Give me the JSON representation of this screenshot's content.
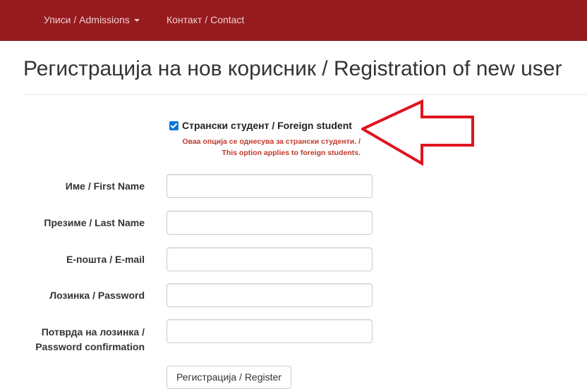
{
  "navbar": {
    "admissions_label": "Уписи / Admissions",
    "contact_label": "Контакт / Contact",
    "background_color": "#951b1e"
  },
  "page": {
    "title": "Регистрација на нов корисник / Registration of new user"
  },
  "foreign_student": {
    "checked": true,
    "label": "Странски студент / Foreign student",
    "note_line1": "Оваа опција се однесува за странски студенти. /",
    "note_line2": "This option applies to foreign students.",
    "note_color": "#c0392b"
  },
  "annotation": {
    "arrow_color": "#e0141e",
    "arrow_direction": "left"
  },
  "form": {
    "fields": [
      {
        "label": "Име / First Name",
        "value": ""
      },
      {
        "label": "Презиме / Last Name",
        "value": ""
      },
      {
        "label": "Е-пошта / E-mail",
        "value": ""
      },
      {
        "label": "Лозинка / Password",
        "value": ""
      },
      {
        "label_line1": "Потврда на лозинка /",
        "label_line2": "Password confirmation",
        "value": ""
      }
    ],
    "submit_label": "Регистрација / Register"
  }
}
